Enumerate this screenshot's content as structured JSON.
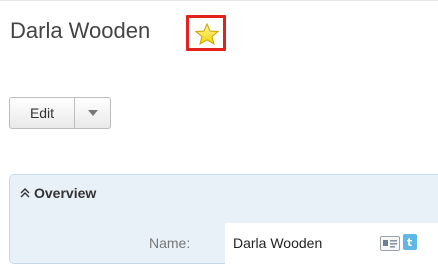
{
  "record": {
    "title": "Darla Wooden",
    "favorite": true
  },
  "actions": {
    "edit_label": "Edit",
    "more_icon": "caret-down-icon"
  },
  "panel": {
    "header": "Overview",
    "fields": [
      {
        "label": "Name:",
        "value": "Darla Wooden"
      }
    ]
  },
  "colors": {
    "highlight": "#e4221b",
    "star_fill": "#ffe94a",
    "panel_bg": "#e8f1f8"
  }
}
